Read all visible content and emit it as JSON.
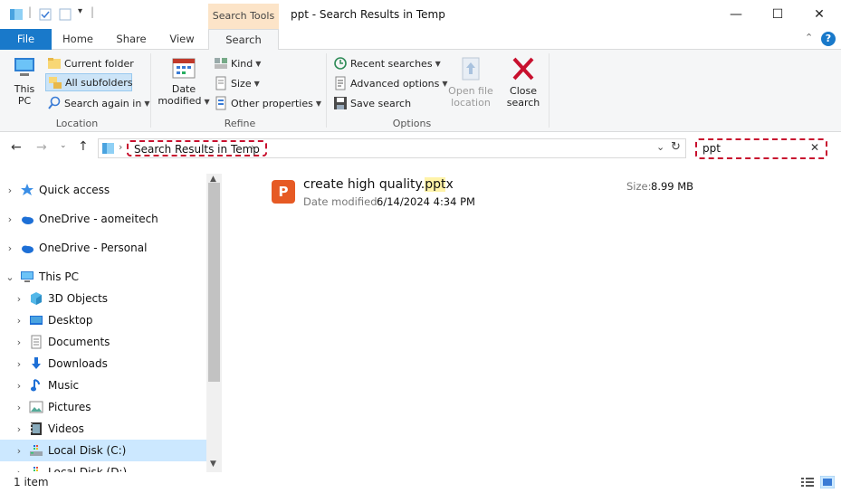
{
  "window": {
    "title": "ppt - Search Results in Temp",
    "context_tab": "Search Tools",
    "minimize": "—",
    "maximize": "☐",
    "close": "✕"
  },
  "tabs": [
    "File",
    "Home",
    "Share",
    "View",
    "Search"
  ],
  "active_tab": "Search",
  "ribbon": {
    "location": {
      "label": "Location",
      "this_pc": [
        "This",
        "PC"
      ],
      "current_folder": "Current folder",
      "all_subfolders": "All subfolders",
      "search_again": "Search again in"
    },
    "refine": {
      "label": "Refine",
      "date_modified": [
        "Date",
        "modified"
      ],
      "kind": "Kind",
      "size": "Size",
      "other_properties": "Other properties"
    },
    "options": {
      "label": "Options",
      "recent_searches": "Recent searches",
      "advanced_options": "Advanced options",
      "save_search": "Save search",
      "open_file_location": [
        "Open file",
        "location"
      ],
      "close_search": [
        "Close",
        "search"
      ]
    }
  },
  "address": {
    "path": "Search Results in Temp",
    "search_value": "ppt"
  },
  "nav_pane": {
    "items": [
      {
        "label": "Quick access",
        "icon": "star-icon",
        "chevron": "›",
        "level": 0
      },
      {
        "label": "OneDrive - aomeitech",
        "icon": "cloud-icon",
        "chevron": "›",
        "level": 0
      },
      {
        "label": "OneDrive - Personal",
        "icon": "cloud-icon",
        "chevron": "›",
        "level": 0
      },
      {
        "label": "This PC",
        "icon": "monitor-icon",
        "chevron": "⌄",
        "level": 0
      },
      {
        "label": "3D Objects",
        "icon": "cube-icon",
        "chevron": "›",
        "level": 1
      },
      {
        "label": "Desktop",
        "icon": "desktop-icon",
        "chevron": "›",
        "level": 1
      },
      {
        "label": "Documents",
        "icon": "document-icon",
        "chevron": "›",
        "level": 1
      },
      {
        "label": "Downloads",
        "icon": "download-icon",
        "chevron": "›",
        "level": 1
      },
      {
        "label": "Music",
        "icon": "music-icon",
        "chevron": "›",
        "level": 1
      },
      {
        "label": "Pictures",
        "icon": "picture-icon",
        "chevron": "›",
        "level": 1
      },
      {
        "label": "Videos",
        "icon": "video-icon",
        "chevron": "›",
        "level": 1
      },
      {
        "label": "Local Disk (C:)",
        "icon": "disk-icon",
        "chevron": "›",
        "level": 1,
        "selected": true
      },
      {
        "label": "Local Disk (D:)",
        "icon": "disk-icon",
        "chevron": "›",
        "level": 1
      }
    ]
  },
  "result": {
    "name_before": "create high quality.",
    "name_match": "ppt",
    "name_after": "x",
    "date_label": "Date modified:",
    "date_value": "6/14/2024 4:34 PM",
    "size_label": "Size:",
    "size_value": "8.99 MB",
    "icon_letter": "P"
  },
  "status": {
    "count": "1 item"
  },
  "colors": {
    "accent": "#1979ca",
    "highlight_border": "#c8102e",
    "ppt_icon": "#e65a24",
    "selection": "#cce8ff"
  }
}
